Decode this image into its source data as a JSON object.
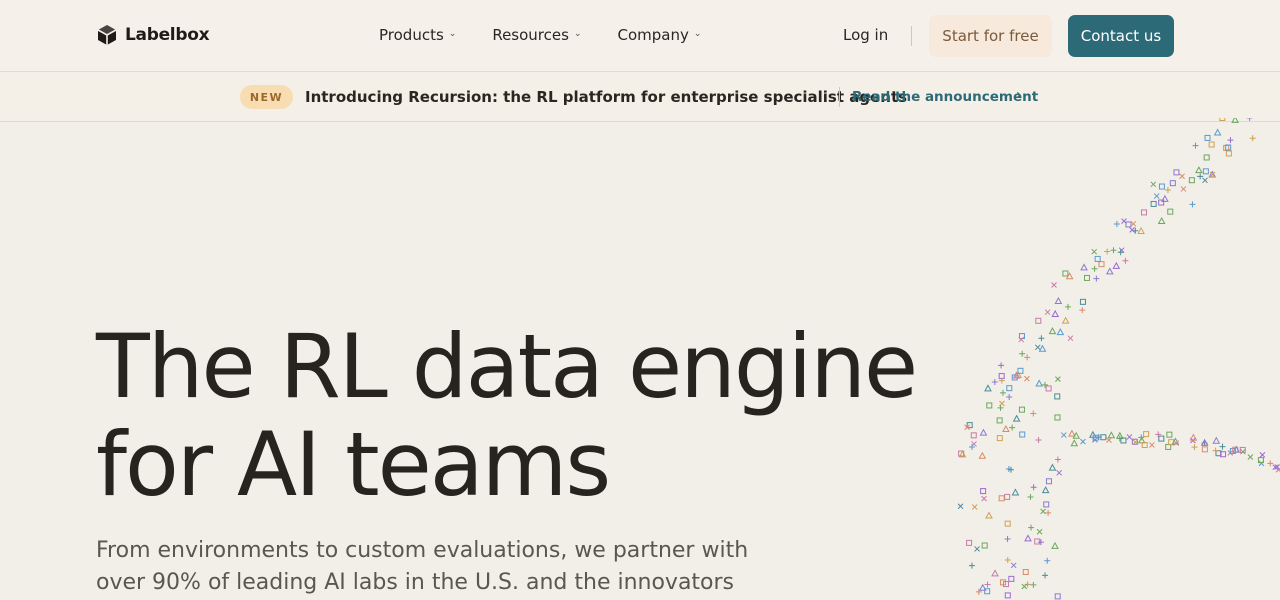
{
  "nav": {
    "logo_text": "Labelbox",
    "menu": [
      {
        "label": "Products"
      },
      {
        "label": "Resources"
      },
      {
        "label": "Company"
      }
    ],
    "login": "Log in",
    "start_label": "Start for free",
    "contact_label": "Contact us"
  },
  "announcement": {
    "badge": "NEW",
    "text": "Introducing Recursion: the RL platform for enterprise specialist agents",
    "link": "Read the announcement"
  },
  "hero": {
    "title_line1": "The RL data engine",
    "title_line2": "for AI teams",
    "subtitle_line1": "From environments to custom evaluations, we partner with",
    "subtitle_line2": "over 90% of leading AI labs in the U.S. and the innovators"
  },
  "colors": {
    "brand": "#2d6a78",
    "start_bg": "#f8ecdd",
    "badge_bg": "#f8ddb3",
    "page_bg": "#f2efe8"
  },
  "icons": {
    "logo": "labelbox-cube-icon",
    "chevron": "chevron-down-icon",
    "link": "chevron-right-icon"
  }
}
